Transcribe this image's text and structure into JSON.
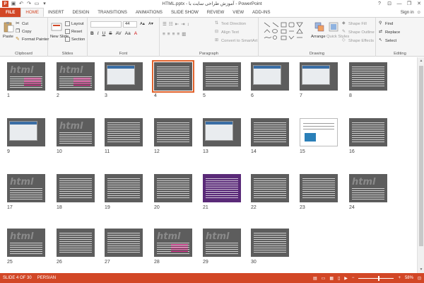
{
  "titlebar": {
    "title": "HTML.pptx - آموزش طراحی سایت با - PowerPoint",
    "minimize": "—",
    "restore": "❐",
    "close": "✕",
    "help": "?"
  },
  "tabs": [
    {
      "label": "FILE"
    },
    {
      "label": "HOME"
    },
    {
      "label": "INSERT"
    },
    {
      "label": "DESIGN"
    },
    {
      "label": "TRANSITIONS"
    },
    {
      "label": "ANIMATIONS"
    },
    {
      "label": "SLIDE SHOW"
    },
    {
      "label": "REVIEW"
    },
    {
      "label": "VIEW"
    },
    {
      "label": "ADD-INS"
    }
  ],
  "signin": "Sign in",
  "ribbon": {
    "clipboard": {
      "paste": "Paste",
      "cut": "Cut",
      "copy": "Copy",
      "format_painter": "Format Painter",
      "label": "Clipboard"
    },
    "slides": {
      "new_slide": "New Slide",
      "layout": "Layout",
      "reset": "Reset",
      "section": "Section",
      "label": "Slides"
    },
    "font": {
      "size": "44",
      "label": "Font"
    },
    "paragraph": {
      "text_direction": "Text Direction",
      "align_text": "Align Text",
      "convert_smartart": "Convert to SmartArt",
      "label": "Paragraph"
    },
    "drawing": {
      "arrange": "Arrange",
      "quick_styles": "Quick Styles",
      "shape_fill": "Shape Fill",
      "shape_outline": "Shape Outline",
      "shape_effects": "Shape Effects",
      "label": "Drawing"
    },
    "editing": {
      "find": "Find",
      "replace": "Replace",
      "select": "Select",
      "label": "Editing"
    }
  },
  "slides": [
    {
      "num": "1",
      "kind": "logo-pink"
    },
    {
      "num": "2",
      "kind": "logo-pink"
    },
    {
      "num": "3",
      "kind": "screenshot"
    },
    {
      "num": "4",
      "kind": "text",
      "selected": true
    },
    {
      "num": "5",
      "kind": "text"
    },
    {
      "num": "6",
      "kind": "screenshot"
    },
    {
      "num": "7",
      "kind": "screenshot"
    },
    {
      "num": "8",
      "kind": "text"
    },
    {
      "num": "9",
      "kind": "screenshot"
    },
    {
      "num": "10",
      "kind": "logo"
    },
    {
      "num": "11",
      "kind": "text"
    },
    {
      "num": "12",
      "kind": "text"
    },
    {
      "num": "13",
      "kind": "screenshot"
    },
    {
      "num": "14",
      "kind": "text"
    },
    {
      "num": "15",
      "kind": "white-doc"
    },
    {
      "num": "16",
      "kind": "text"
    },
    {
      "num": "17",
      "kind": "logo"
    },
    {
      "num": "18",
      "kind": "text"
    },
    {
      "num": "19",
      "kind": "text"
    },
    {
      "num": "20",
      "kind": "text"
    },
    {
      "num": "21",
      "kind": "purple"
    },
    {
      "num": "22",
      "kind": "text"
    },
    {
      "num": "23",
      "kind": "text"
    },
    {
      "num": "24",
      "kind": "logo"
    },
    {
      "num": "25",
      "kind": "logo"
    },
    {
      "num": "26",
      "kind": "text"
    },
    {
      "num": "27",
      "kind": "text"
    },
    {
      "num": "28",
      "kind": "logo-pink"
    },
    {
      "num": "29",
      "kind": "logo"
    },
    {
      "num": "30",
      "kind": "text"
    }
  ],
  "statusbar": {
    "slide_info": "SLIDE 4 OF 30",
    "language": "PERSIAN",
    "zoom": "58%",
    "zoom_level": 0.58
  },
  "colors": {
    "accent": "#d24726",
    "selection": "#e0622c",
    "thumb_bg": "#5d5d5d"
  }
}
